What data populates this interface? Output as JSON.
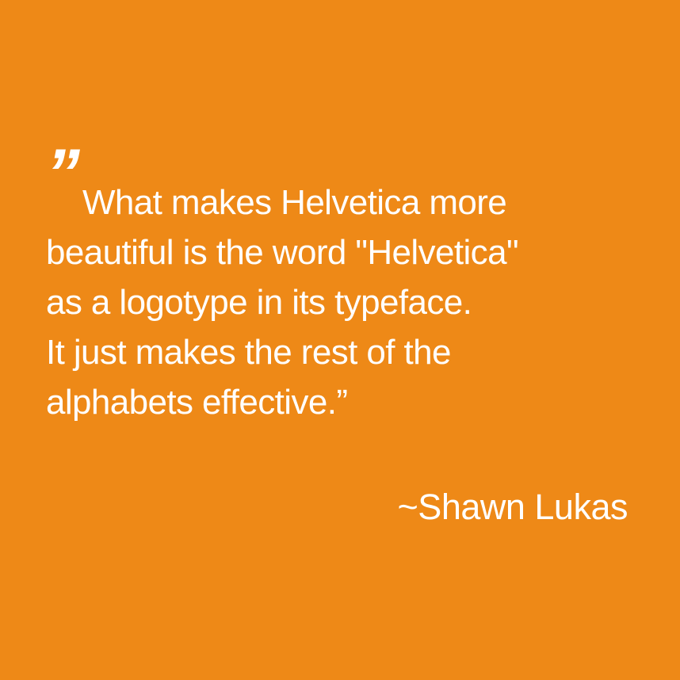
{
  "colors": {
    "background": "#ee8917",
    "text": "#ffffff"
  },
  "quote": {
    "open_mark": "”",
    "lines": [
      "What makes Helvetica more",
      "beautiful is the word \"Helvetica\"",
      "as a logotype in its typeface.",
      "It just makes the rest of the",
      "alphabets effective.”"
    ]
  },
  "attribution": "~Shawn Lukas"
}
